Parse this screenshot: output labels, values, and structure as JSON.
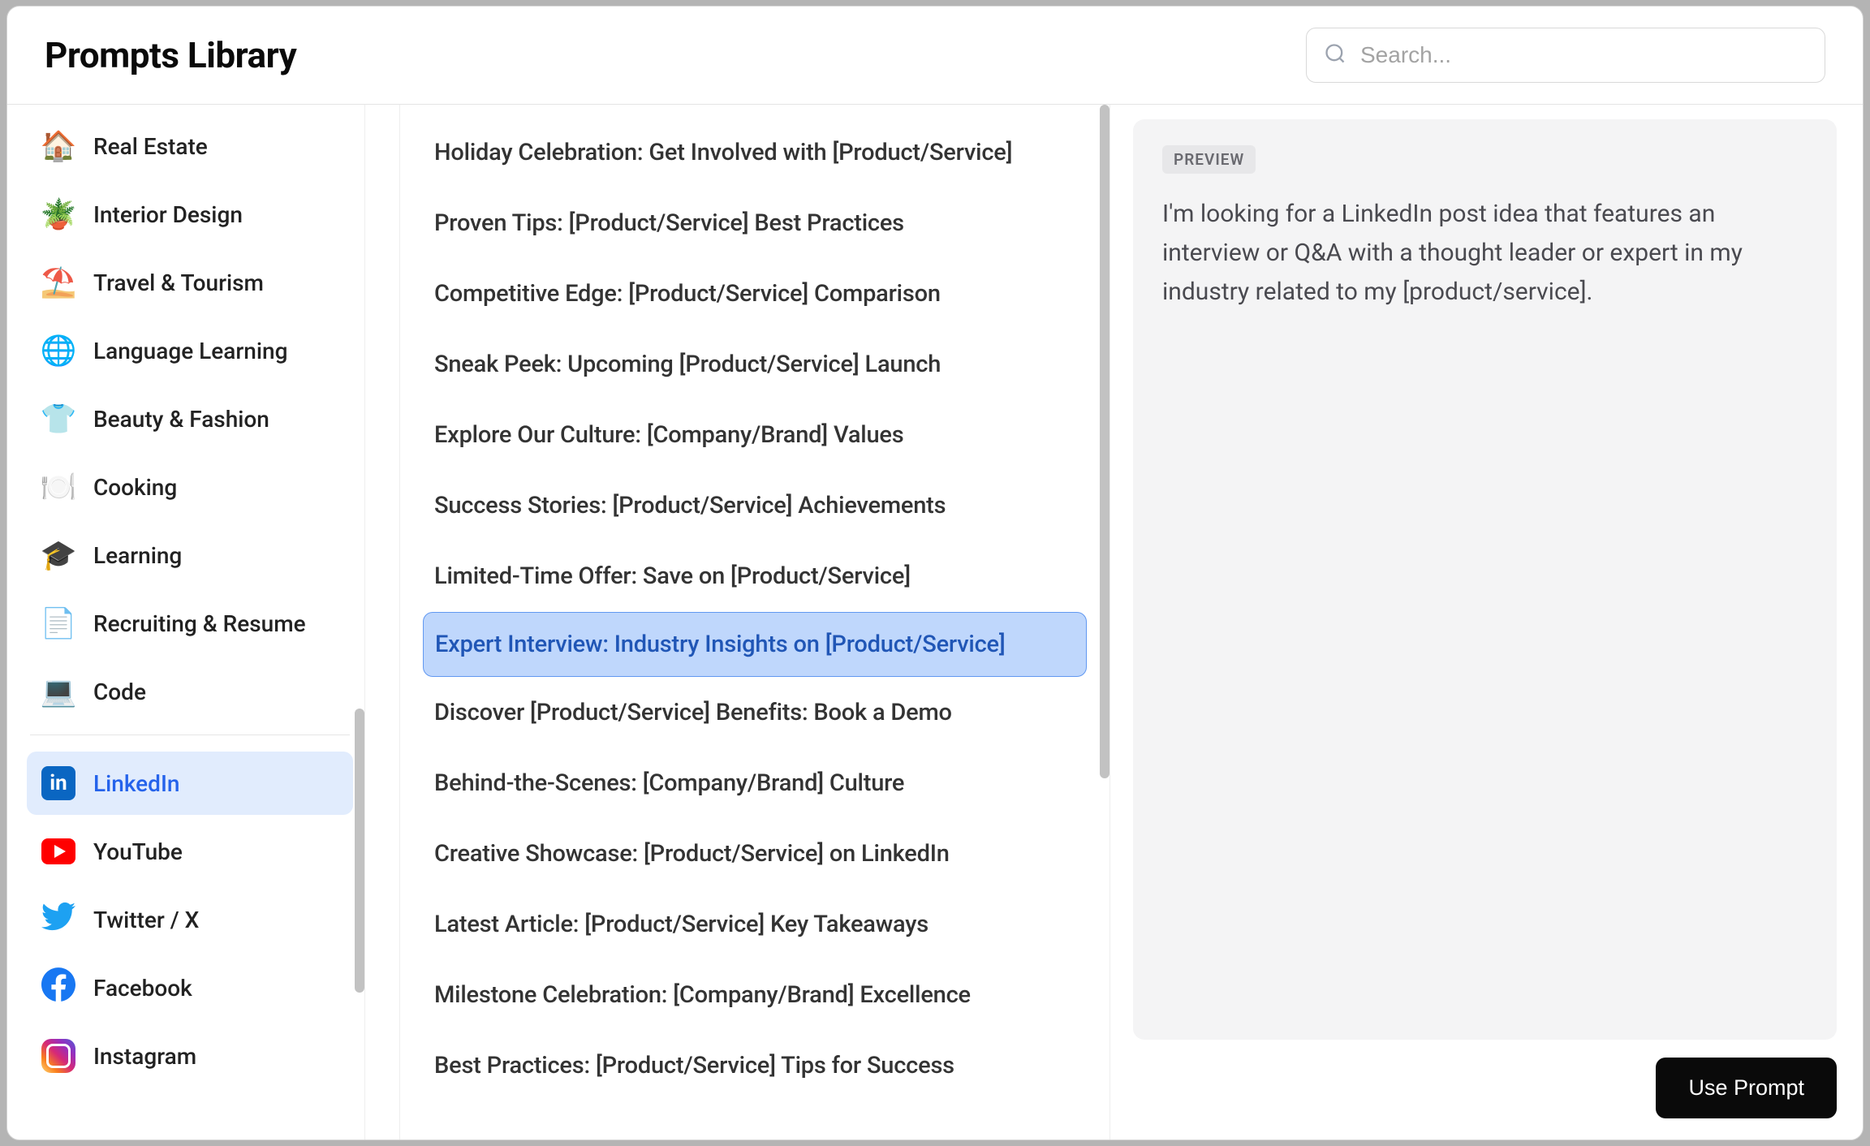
{
  "header": {
    "title": "Prompts Library",
    "search_placeholder": "Search..."
  },
  "sidebar": {
    "categories": [
      {
        "icon": "🏠",
        "label": "Real Estate"
      },
      {
        "icon": "🪴",
        "label": "Interior Design"
      },
      {
        "icon": "⛱️",
        "label": "Travel & Tourism"
      },
      {
        "icon": "🌐",
        "label": "Language Learning"
      },
      {
        "icon": "👕",
        "label": "Beauty & Fashion"
      },
      {
        "icon": "🍽️",
        "label": "Cooking"
      },
      {
        "icon": "🎓",
        "label": "Learning"
      },
      {
        "icon": "📄",
        "label": "Recruiting & Resume"
      },
      {
        "icon": "💻",
        "label": "Code"
      }
    ],
    "social": [
      {
        "icon": "linkedin",
        "label": "LinkedIn",
        "active": true
      },
      {
        "icon": "youtube",
        "label": "YouTube"
      },
      {
        "icon": "twitter",
        "label": "Twitter / X"
      },
      {
        "icon": "facebook",
        "label": "Facebook"
      },
      {
        "icon": "instagram",
        "label": "Instagram"
      }
    ]
  },
  "prompts": [
    {
      "title": "Holiday Celebration: Get Involved with [Product/Service]"
    },
    {
      "title": "Proven Tips: [Product/Service] Best Practices"
    },
    {
      "title": "Competitive Edge: [Product/Service] Comparison"
    },
    {
      "title": "Sneak Peek: Upcoming [Product/Service] Launch"
    },
    {
      "title": "Explore Our Culture: [Company/Brand] Values"
    },
    {
      "title": "Success Stories: [Product/Service] Achievements"
    },
    {
      "title": "Limited-Time Offer: Save on [Product/Service]"
    },
    {
      "title": "Expert Interview: Industry Insights on [Product/Service]",
      "selected": true
    },
    {
      "title": "Discover [Product/Service] Benefits: Book a Demo"
    },
    {
      "title": "Behind-the-Scenes: [Company/Brand] Culture"
    },
    {
      "title": "Creative Showcase: [Product/Service] on LinkedIn"
    },
    {
      "title": "Latest Article: [Product/Service] Key Takeaways"
    },
    {
      "title": "Milestone Celebration: [Company/Brand] Excellence"
    },
    {
      "title": "Best Practices: [Product/Service] Tips for Success"
    }
  ],
  "preview": {
    "badge": "PREVIEW",
    "text": "I'm looking for a LinkedIn post idea that features an interview or Q&A with a thought leader or expert in my industry related to my [product/service]."
  },
  "actions": {
    "use_prompt": "Use Prompt"
  }
}
